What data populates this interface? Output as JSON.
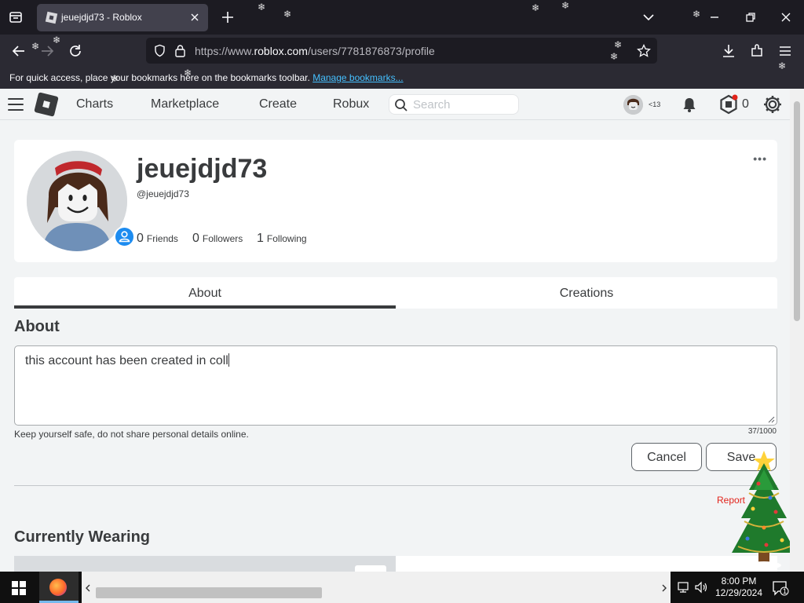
{
  "browser": {
    "tab_title": "jeuejdjd73 - Roblox",
    "url_prefix": "https://www.",
    "url_domain": "roblox.com",
    "url_path": "/users/7781876873/profile",
    "bookmarks_message": "For quick access, place your bookmarks here on the bookmarks toolbar.",
    "bookmarks_link": "Manage bookmarks..."
  },
  "header": {
    "nav": [
      "Charts",
      "Marketplace",
      "Create",
      "Robux"
    ],
    "search_placeholder": "Search",
    "age_badge": "<13",
    "robux": "0"
  },
  "profile": {
    "display_name": "jeuejdjd73",
    "username": "@jeuejdjd73",
    "stats": [
      {
        "count": "0",
        "label": "Friends"
      },
      {
        "count": "0",
        "label": "Followers"
      },
      {
        "count": "1",
        "label": "Following"
      }
    ],
    "more": "•••"
  },
  "tabs": [
    "About",
    "Creations"
  ],
  "about": {
    "title": "About",
    "text": "this account has been created in coll",
    "safety_note": "Keep yourself safe, do not share personal details online.",
    "counter": "37/1000",
    "cancel": "Cancel",
    "save": "Save",
    "report": "Report"
  },
  "wearing": {
    "title": "Currently Wearing"
  },
  "taskbar": {
    "time": "8:00 PM",
    "date": "12/29/2024",
    "notifications": "1"
  }
}
